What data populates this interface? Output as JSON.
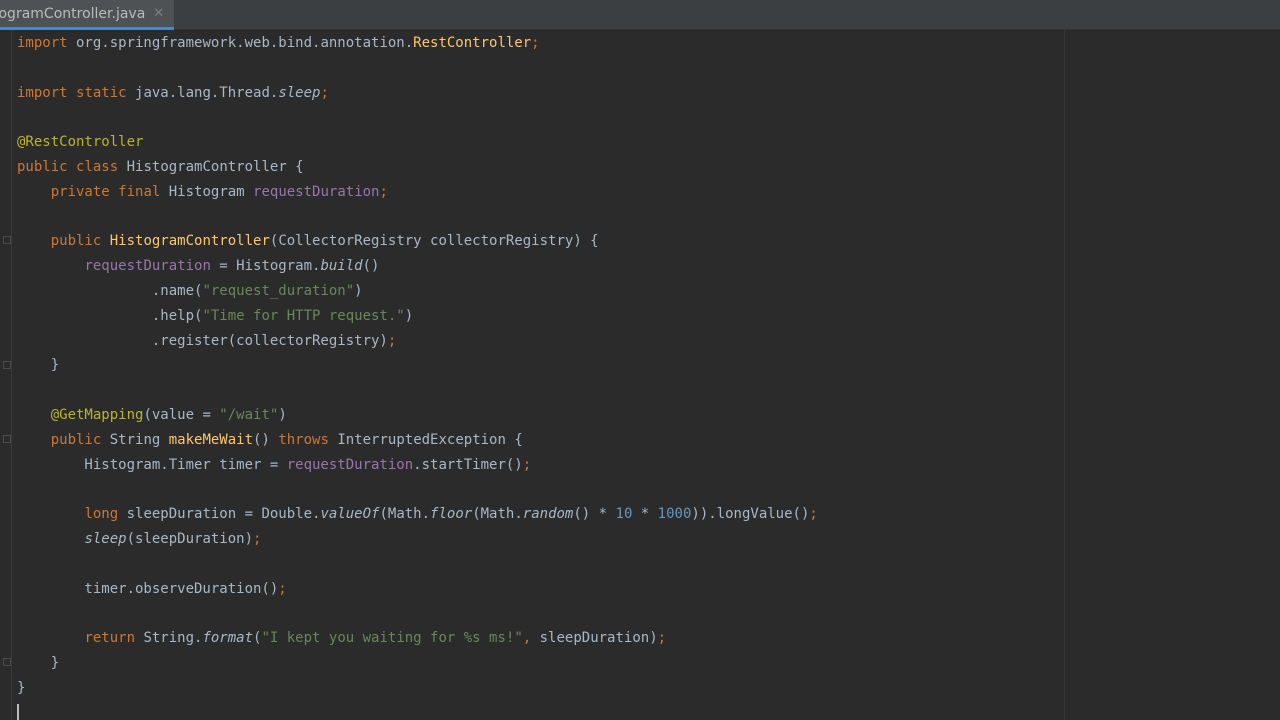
{
  "tab": {
    "label": "togramController.java",
    "close_glyph": "✕"
  },
  "code": {
    "lines": [
      [
        {
          "t": "import",
          "c": "kw"
        },
        {
          "t": " org.springframework.web.bind.annotation.",
          "c": ""
        },
        {
          "t": "RestController",
          "c": "mth"
        },
        {
          "t": ";",
          "c": "kw"
        }
      ],
      [],
      [
        {
          "t": "import",
          "c": "kw"
        },
        {
          "t": " ",
          "c": ""
        },
        {
          "t": "static",
          "c": "kw"
        },
        {
          "t": " java.lang.Thread.",
          "c": ""
        },
        {
          "t": "sleep",
          "c": "it"
        },
        {
          "t": ";",
          "c": "kw"
        }
      ],
      [],
      [
        {
          "t": "@RestController",
          "c": "ann"
        }
      ],
      [
        {
          "t": "public",
          "c": "kw"
        },
        {
          "t": " ",
          "c": ""
        },
        {
          "t": "class",
          "c": "kw"
        },
        {
          "t": " HistogramController {",
          "c": ""
        }
      ],
      [
        {
          "t": "    ",
          "c": ""
        },
        {
          "t": "private",
          "c": "kw"
        },
        {
          "t": " ",
          "c": ""
        },
        {
          "t": "final",
          "c": "kw"
        },
        {
          "t": " Histogram ",
          "c": ""
        },
        {
          "t": "requestDuration",
          "c": "fld"
        },
        {
          "t": ";",
          "c": "kw"
        }
      ],
      [],
      [
        {
          "t": "    ",
          "c": ""
        },
        {
          "t": "public",
          "c": "kw"
        },
        {
          "t": " ",
          "c": ""
        },
        {
          "t": "HistogramController",
          "c": "mth"
        },
        {
          "t": "(CollectorRegistry collectorRegistry) {",
          "c": ""
        }
      ],
      [
        {
          "t": "        ",
          "c": ""
        },
        {
          "t": "requestDuration",
          "c": "fld"
        },
        {
          "t": " = Histogram.",
          "c": ""
        },
        {
          "t": "build",
          "c": "it"
        },
        {
          "t": "()",
          "c": ""
        }
      ],
      [
        {
          "t": "                .name(",
          "c": ""
        },
        {
          "t": "\"request_duration\"",
          "c": "str"
        },
        {
          "t": ")",
          "c": ""
        }
      ],
      [
        {
          "t": "                .help(",
          "c": ""
        },
        {
          "t": "\"Time for HTTP request.\"",
          "c": "str"
        },
        {
          "t": ")",
          "c": ""
        }
      ],
      [
        {
          "t": "                .register(collectorRegistry)",
          "c": ""
        },
        {
          "t": ";",
          "c": "kw"
        }
      ],
      [
        {
          "t": "    }",
          "c": ""
        }
      ],
      [],
      [
        {
          "t": "    ",
          "c": ""
        },
        {
          "t": "@GetMapping",
          "c": "ann"
        },
        {
          "t": "(value = ",
          "c": ""
        },
        {
          "t": "\"/wait\"",
          "c": "str"
        },
        {
          "t": ")",
          "c": ""
        }
      ],
      [
        {
          "t": "    ",
          "c": ""
        },
        {
          "t": "public",
          "c": "kw"
        },
        {
          "t": " String ",
          "c": ""
        },
        {
          "t": "makeMeWait",
          "c": "mth"
        },
        {
          "t": "() ",
          "c": ""
        },
        {
          "t": "throws",
          "c": "kw"
        },
        {
          "t": " InterruptedException {",
          "c": ""
        }
      ],
      [
        {
          "t": "        Histogram.Timer timer = ",
          "c": ""
        },
        {
          "t": "requestDuration",
          "c": "fld"
        },
        {
          "t": ".startTimer()",
          "c": ""
        },
        {
          "t": ";",
          "c": "kw"
        }
      ],
      [],
      [
        {
          "t": "        ",
          "c": ""
        },
        {
          "t": "long",
          "c": "kw"
        },
        {
          "t": " sleepDuration = Double.",
          "c": ""
        },
        {
          "t": "valueOf",
          "c": "it"
        },
        {
          "t": "(Math.",
          "c": ""
        },
        {
          "t": "floor",
          "c": "it"
        },
        {
          "t": "(Math.",
          "c": ""
        },
        {
          "t": "random",
          "c": "it"
        },
        {
          "t": "() * ",
          "c": ""
        },
        {
          "t": "10",
          "c": "num"
        },
        {
          "t": " * ",
          "c": ""
        },
        {
          "t": "1000",
          "c": "num"
        },
        {
          "t": ")).longValue()",
          "c": ""
        },
        {
          "t": ";",
          "c": "kw"
        }
      ],
      [
        {
          "t": "        ",
          "c": ""
        },
        {
          "t": "sleep",
          "c": "it"
        },
        {
          "t": "(sleepDuration)",
          "c": ""
        },
        {
          "t": ";",
          "c": "kw"
        }
      ],
      [],
      [
        {
          "t": "        timer.observeDuration()",
          "c": ""
        },
        {
          "t": ";",
          "c": "kw"
        }
      ],
      [],
      [
        {
          "t": "        ",
          "c": ""
        },
        {
          "t": "return",
          "c": "kw"
        },
        {
          "t": " String.",
          "c": ""
        },
        {
          "t": "format",
          "c": "it"
        },
        {
          "t": "(",
          "c": ""
        },
        {
          "t": "\"I kept you waiting for %s ms!\"",
          "c": "str"
        },
        {
          "t": ", ",
          "c": "kw"
        },
        {
          "t": "sleepDuration)",
          "c": ""
        },
        {
          "t": ";",
          "c": "kw"
        }
      ],
      [
        {
          "t": "    }",
          "c": ""
        }
      ],
      [
        {
          "t": "}",
          "c": ""
        }
      ]
    ]
  }
}
